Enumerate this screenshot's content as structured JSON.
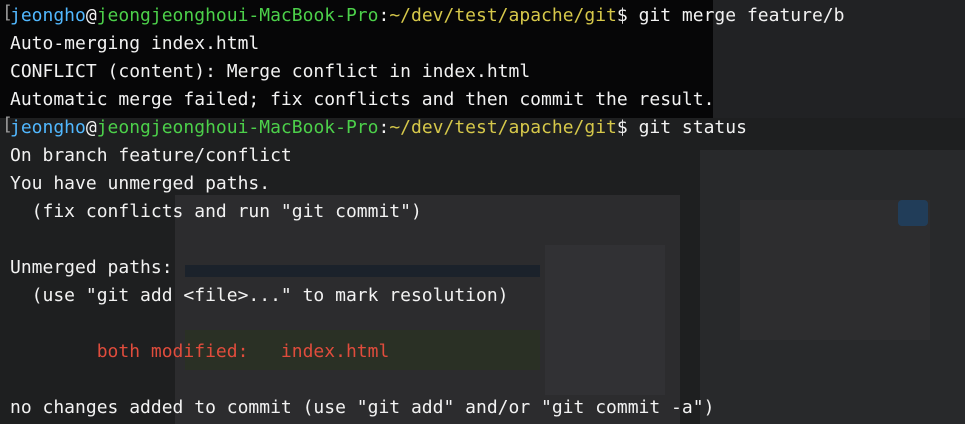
{
  "prompt": {
    "user": "jeongho",
    "at": "@",
    "host": "jeongjeonghoui-MacBook-Pro",
    "colon": ":",
    "path": "~/dev/test/apache/git",
    "dollar": "$ "
  },
  "lines": [
    {
      "type": "prompt",
      "command": "git merge feature/b"
    },
    {
      "type": "text",
      "text": "Auto-merging index.html"
    },
    {
      "type": "text",
      "text": "CONFLICT (content): Merge conflict in index.html"
    },
    {
      "type": "text",
      "text": "Automatic merge failed; fix conflicts and then commit the result."
    },
    {
      "type": "prompt",
      "command": "git status"
    },
    {
      "type": "text",
      "text": "On branch feature/conflict"
    },
    {
      "type": "text",
      "text": "You have unmerged paths."
    },
    {
      "type": "text",
      "text": "  (fix conflicts and run \"git commit\")"
    },
    {
      "type": "text",
      "text": ""
    },
    {
      "type": "text",
      "text": "Unmerged paths:"
    },
    {
      "type": "text",
      "text": "  (use \"git add <file>...\" to mark resolution)"
    },
    {
      "type": "text",
      "text": ""
    },
    {
      "type": "status",
      "text": "        both modified:   index.html"
    },
    {
      "type": "text",
      "text": ""
    },
    {
      "type": "text",
      "text": "no changes added to commit (use \"git add\" and/or \"git commit -a\")"
    }
  ],
  "colors": {
    "user": "#51b8ff",
    "host": "#4cd04a",
    "path": "#d6c84a",
    "conflict": "#e04c3c",
    "text": "#f2f2f2"
  }
}
